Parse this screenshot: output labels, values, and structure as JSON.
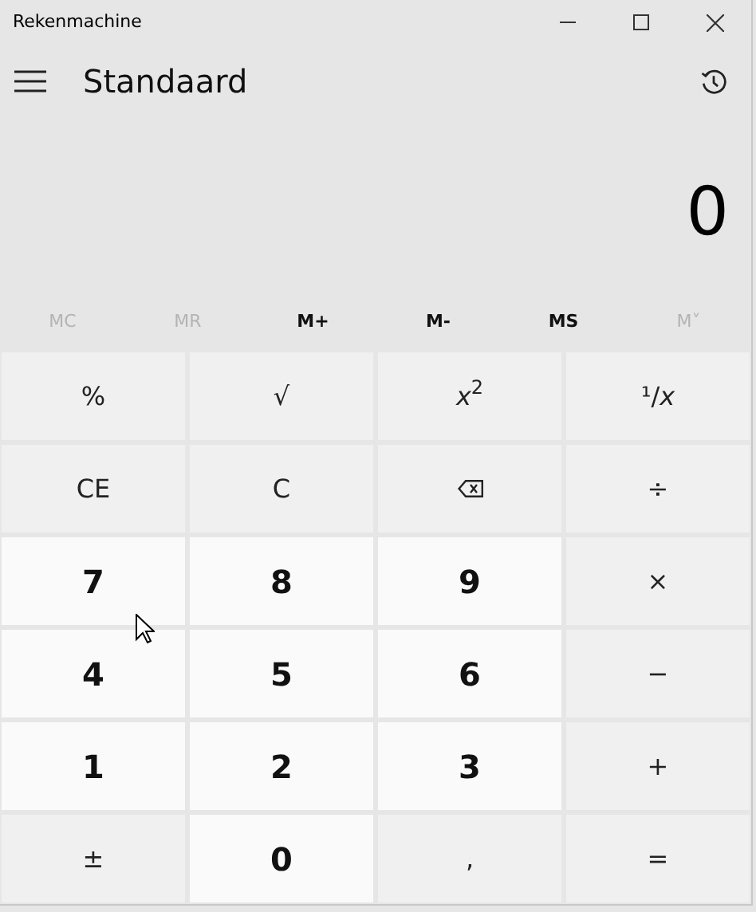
{
  "window": {
    "title": "Rekenmachine"
  },
  "mode": {
    "title": "Standaard"
  },
  "display": {
    "value": "0"
  },
  "memory": [
    {
      "label": "MC",
      "disabled": true
    },
    {
      "label": "MR",
      "disabled": true
    },
    {
      "label": "M+",
      "disabled": false
    },
    {
      "label": "M-",
      "disabled": false
    },
    {
      "label": "MS",
      "disabled": false
    },
    {
      "label": "M˅",
      "disabled": true
    }
  ],
  "keys": [
    {
      "kind": "op",
      "label": "%"
    },
    {
      "kind": "op",
      "label": "√"
    },
    {
      "kind": "op",
      "label": "*x*$^{2}$"
    },
    {
      "kind": "op",
      "label": "¹/*x*"
    },
    {
      "kind": "op",
      "label": "CE"
    },
    {
      "kind": "op",
      "label": "C"
    },
    {
      "kind": "backspace"
    },
    {
      "kind": "op",
      "label": "÷"
    },
    {
      "kind": "digit",
      "label": "7"
    },
    {
      "kind": "digit",
      "label": "8"
    },
    {
      "kind": "digit",
      "label": "9"
    },
    {
      "kind": "op",
      "label": "×"
    },
    {
      "kind": "digit",
      "label": "4"
    },
    {
      "kind": "digit",
      "label": "5"
    },
    {
      "kind": "digit",
      "label": "6"
    },
    {
      "kind": "op",
      "label": "−"
    },
    {
      "kind": "digit",
      "label": "1"
    },
    {
      "kind": "digit",
      "label": "2"
    },
    {
      "kind": "digit",
      "label": "3"
    },
    {
      "kind": "op",
      "label": "+"
    },
    {
      "kind": "op",
      "label": "±"
    },
    {
      "kind": "digit",
      "label": "0"
    },
    {
      "kind": "op",
      "label": ","
    },
    {
      "kind": "op",
      "label": "="
    }
  ]
}
